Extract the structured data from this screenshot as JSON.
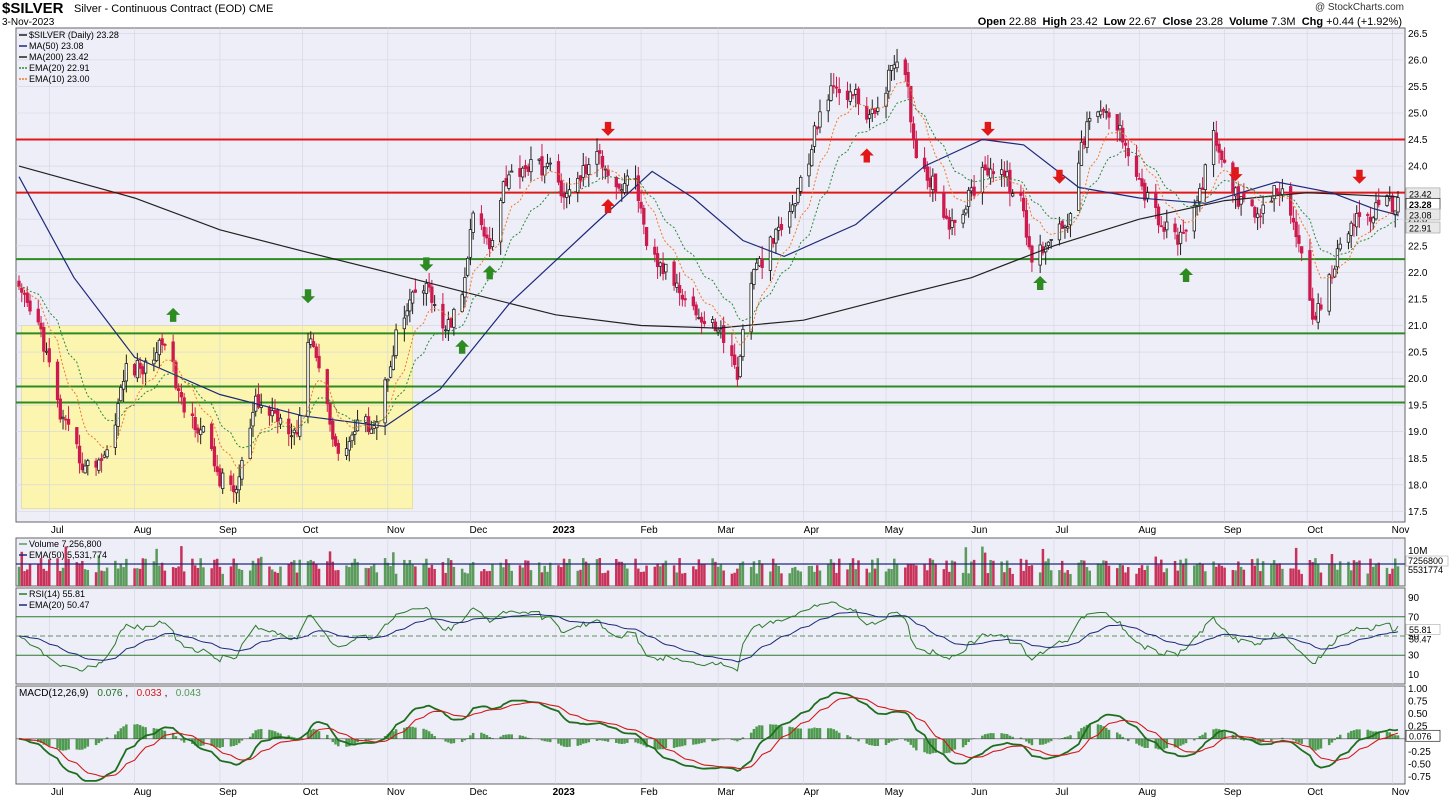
{
  "header": {
    "symbol": "$SILVER",
    "description": "Silver - Continuous Contract (EOD)",
    "exchange": "CME",
    "date": "3-Nov-2023",
    "copyright": "@ StockCharts.com",
    "open_label": "Open",
    "open": "22.88",
    "high_label": "High",
    "high": "23.42",
    "low_label": "Low",
    "low": "22.67",
    "close_label": "Close",
    "close": "23.28",
    "volume_label": "Volume",
    "volume": "7.3M",
    "chg_label": "Chg",
    "chg": "+0.44 (+1.92%)"
  },
  "colors": {
    "plot_bg": "#eeeef8",
    "up": "#1f1f1f",
    "down": "#cc1b4e",
    "ma50": "#1d2a7a",
    "ma200": "#222222",
    "ema20": "#2b8a3a",
    "ema10": "#f07a2a",
    "resistance": "#e01818",
    "support": "#2e8b22",
    "zone": "#fbf5b0",
    "vol_up": "#5a9a5a",
    "vol_down": "#c8325a",
    "rsi": "#2a7a2a",
    "macd": "#1f6e1f",
    "macd_signal": "#d21a1a",
    "hist": "#4e9a4e"
  },
  "legend_price": [
    "$SILVER (Daily) 23.28",
    "MA(50) 23.08",
    "MA(200) 23.42",
    "EMA(20) 22.91",
    "EMA(10) 23.00"
  ],
  "legend_volume": [
    "Volume 7,256,800",
    "EMA(50) 5,531,774"
  ],
  "legend_rsi": [
    "RSI(14) 55.81",
    "EMA(20) 50.47"
  ],
  "legend_macd": [
    "MACD(12,26,9) ",
    "0.076",
    ", ",
    "0.033",
    ", ",
    "0.043"
  ],
  "chart_data": [
    {
      "type": "candlestick",
      "title": "$SILVER (Daily) 23.28",
      "x_labels": [
        "Jul",
        "Aug",
        "Sep",
        "Oct",
        "Nov",
        "Dec",
        "2023",
        "Feb",
        "Mar",
        "Apr",
        "May",
        "Jun",
        "Jul",
        "Aug",
        "Sep",
        "Oct",
        "Nov"
      ],
      "x_start": "2022-06-20",
      "x_end": "2023-11-03",
      "y_ticks": [
        17.5,
        18.0,
        18.5,
        19.0,
        19.5,
        20.0,
        20.5,
        21.0,
        21.5,
        22.0,
        22.5,
        23.0,
        23.5,
        24.0,
        24.5,
        25.0,
        25.5,
        26.0,
        26.5
      ],
      "ylim": [
        17.3,
        26.6
      ],
      "close_path": [
        [
          "2022-06-20",
          21.6
        ],
        [
          "2022-06-28",
          20.9
        ],
        [
          "2022-07-05",
          19.3
        ],
        [
          "2022-07-14",
          18.3
        ],
        [
          "2022-07-22",
          18.6
        ],
        [
          "2022-07-29",
          20.2
        ],
        [
          "2022-08-05",
          20.2
        ],
        [
          "2022-08-12",
          20.8
        ],
        [
          "2022-08-18",
          19.5
        ],
        [
          "2022-08-26",
          19.0
        ],
        [
          "2022-09-01",
          18.1
        ],
        [
          "2022-09-07",
          17.9
        ],
        [
          "2022-09-14",
          19.5
        ],
        [
          "2022-09-22",
          19.3
        ],
        [
          "2022-09-29",
          19.0
        ],
        [
          "2022-10-04",
          20.9
        ],
        [
          "2022-10-10",
          19.5
        ],
        [
          "2022-10-14",
          18.5
        ],
        [
          "2022-10-21",
          19.1
        ],
        [
          "2022-10-28",
          19.2
        ],
        [
          "2022-11-04",
          20.8
        ],
        [
          "2022-11-11",
          21.6
        ],
        [
          "2022-11-16",
          21.7
        ],
        [
          "2022-11-21",
          20.8
        ],
        [
          "2022-11-28",
          21.5
        ],
        [
          "2022-12-02",
          23.1
        ],
        [
          "2022-12-08",
          22.5
        ],
        [
          "2022-12-13",
          23.7
        ],
        [
          "2022-12-20",
          24.0
        ],
        [
          "2022-12-29",
          24.0
        ],
        [
          "2023-01-05",
          23.4
        ],
        [
          "2023-01-11",
          23.9
        ],
        [
          "2023-01-17",
          24.2
        ],
        [
          "2023-01-24",
          23.6
        ],
        [
          "2023-01-30",
          23.8
        ],
        [
          "2023-02-03",
          22.4
        ],
        [
          "2023-02-10",
          22.0
        ],
        [
          "2023-02-17",
          21.6
        ],
        [
          "2023-02-24",
          21.0
        ],
        [
          "2023-03-01",
          21.0
        ],
        [
          "2023-03-08",
          20.1
        ],
        [
          "2023-03-13",
          21.9
        ],
        [
          "2023-03-20",
          22.5
        ],
        [
          "2023-03-27",
          23.1
        ],
        [
          "2023-04-03",
          24.1
        ],
        [
          "2023-04-07",
          25.1
        ],
        [
          "2023-04-13",
          25.5
        ],
        [
          "2023-04-20",
          25.3
        ],
        [
          "2023-04-26",
          24.9
        ],
        [
          "2023-05-03",
          25.8
        ],
        [
          "2023-05-08",
          25.8
        ],
        [
          "2023-05-12",
          24.2
        ],
        [
          "2023-05-18",
          23.7
        ],
        [
          "2023-05-25",
          22.8
        ],
        [
          "2023-05-31",
          23.4
        ],
        [
          "2023-06-06",
          24.0
        ],
        [
          "2023-06-12",
          23.9
        ],
        [
          "2023-06-19",
          23.3
        ],
        [
          "2023-06-23",
          22.2
        ],
        [
          "2023-06-30",
          22.7
        ],
        [
          "2023-07-06",
          23.0
        ],
        [
          "2023-07-13",
          24.8
        ],
        [
          "2023-07-20",
          25.0
        ],
        [
          "2023-07-27",
          24.5
        ],
        [
          "2023-08-02",
          23.6
        ],
        [
          "2023-08-09",
          22.9
        ],
        [
          "2023-08-15",
          22.6
        ],
        [
          "2023-08-21",
          23.1
        ],
        [
          "2023-08-28",
          24.5
        ],
        [
          "2023-09-01",
          24.0
        ],
        [
          "2023-09-07",
          23.3
        ],
        [
          "2023-09-14",
          23.0
        ],
        [
          "2023-09-20",
          23.6
        ],
        [
          "2023-09-26",
          23.1
        ],
        [
          "2023-09-29",
          22.2
        ],
        [
          "2023-10-03",
          21.0
        ],
        [
          "2023-10-09",
          21.8
        ],
        [
          "2023-10-13",
          22.5
        ],
        [
          "2023-10-18",
          23.0
        ],
        [
          "2023-10-24",
          23.1
        ],
        [
          "2023-10-30",
          23.3
        ],
        [
          "2023-11-03",
          23.28
        ]
      ],
      "ma200_path": [
        [
          "2022-06-20",
          24.0
        ],
        [
          "2022-08-01",
          23.4
        ],
        [
          "2022-09-01",
          22.8
        ],
        [
          "2022-10-01",
          22.4
        ],
        [
          "2022-11-01",
          22.0
        ],
        [
          "2022-12-01",
          21.6
        ],
        [
          "2023-01-01",
          21.2
        ],
        [
          "2023-02-01",
          21.0
        ],
        [
          "2023-03-01",
          20.95
        ],
        [
          "2023-04-01",
          21.1
        ],
        [
          "2023-05-01",
          21.5
        ],
        [
          "2023-06-01",
          21.9
        ],
        [
          "2023-07-01",
          22.5
        ],
        [
          "2023-08-01",
          23.0
        ],
        [
          "2023-09-01",
          23.35
        ],
        [
          "2023-10-01",
          23.5
        ],
        [
          "2023-11-03",
          23.42
        ]
      ],
      "ma50_path": [
        [
          "2022-06-20",
          23.8
        ],
        [
          "2022-07-10",
          21.9
        ],
        [
          "2022-08-01",
          20.4
        ],
        [
          "2022-09-01",
          19.7
        ],
        [
          "2022-10-01",
          19.3
        ],
        [
          "2022-10-31",
          19.1
        ],
        [
          "2022-11-20",
          19.8
        ],
        [
          "2022-12-15",
          21.4
        ],
        [
          "2023-01-15",
          22.9
        ],
        [
          "2023-02-05",
          23.9
        ],
        [
          "2023-02-20",
          23.4
        ],
        [
          "2023-03-10",
          22.6
        ],
        [
          "2023-03-25",
          22.3
        ],
        [
          "2023-04-20",
          22.9
        ],
        [
          "2023-05-15",
          24.0
        ],
        [
          "2023-06-05",
          24.5
        ],
        [
          "2023-06-20",
          24.4
        ],
        [
          "2023-07-10",
          23.6
        ],
        [
          "2023-08-01",
          23.4
        ],
        [
          "2023-08-25",
          23.3
        ],
        [
          "2023-09-20",
          23.7
        ],
        [
          "2023-10-10",
          23.5
        ],
        [
          "2023-10-25",
          23.2
        ],
        [
          "2023-11-03",
          23.08
        ]
      ],
      "horizontal_levels": {
        "resistance": [
          24.5,
          23.5
        ],
        "support": [
          22.25,
          20.85,
          19.85,
          19.55
        ]
      },
      "highlight_zone": {
        "x": [
          "2022-06-21",
          "2022-11-10"
        ],
        "y": [
          17.55,
          21.0
        ]
      },
      "markers": {
        "up_green": [
          [
            "2022-08-15",
            21.2
          ],
          [
            "2022-10-03",
            21.55
          ],
          [
            "2022-11-15",
            22.15
          ],
          [
            "2022-11-28",
            20.6
          ],
          [
            "2022-12-08",
            22.0
          ],
          [
            "2023-06-26",
            21.8
          ],
          [
            "2023-08-18",
            21.95
          ]
        ],
        "down_red": [
          [
            "2023-01-20",
            24.7
          ],
          [
            "2023-06-07",
            24.7
          ],
          [
            "2023-07-03",
            23.8
          ],
          [
            "2023-09-05",
            23.85
          ],
          [
            "2023-10-20",
            23.8
          ]
        ],
        "up_red": [
          [
            "2023-01-20",
            23.25
          ],
          [
            "2023-04-24",
            24.2
          ]
        ]
      },
      "right_labels": [
        "23.42",
        "23.28",
        "23.08",
        "22.91"
      ]
    },
    {
      "type": "bar",
      "title": "Volume 7,256,800",
      "series": [
        {
          "name": "Volume"
        },
        {
          "name": "EMA(50) 5,531,774"
        }
      ],
      "y_ticks_labels": [
        "10M",
        "7256800",
        "5531774"
      ]
    },
    {
      "type": "line",
      "title": "RSI(14) 55.81",
      "series": [
        {
          "name": "RSI(14)"
        },
        {
          "name": "EMA(20)"
        }
      ],
      "y_ticks": [
        90,
        70,
        50,
        30,
        10
      ],
      "ylim": [
        0,
        100
      ],
      "right_labels": [
        "55.81",
        "50.47"
      ]
    },
    {
      "type": "line",
      "title": "MACD(12,26,9) 0.076, 0.033, 0.043",
      "series": [
        {
          "name": "MACD"
        },
        {
          "name": "Signal"
        },
        {
          "name": "Histogram"
        }
      ],
      "y_ticks": [
        1.0,
        0.75,
        0.5,
        0.25,
        -0.25,
        -0.5,
        -0.75
      ],
      "y_tick_labels": [
        "1.00",
        "0.75",
        "0.50",
        "0.25",
        "",
        "-0.25",
        "-0.50",
        "-0.75"
      ],
      "ylim": [
        -0.9,
        1.05
      ],
      "right_label": "0.076"
    }
  ]
}
